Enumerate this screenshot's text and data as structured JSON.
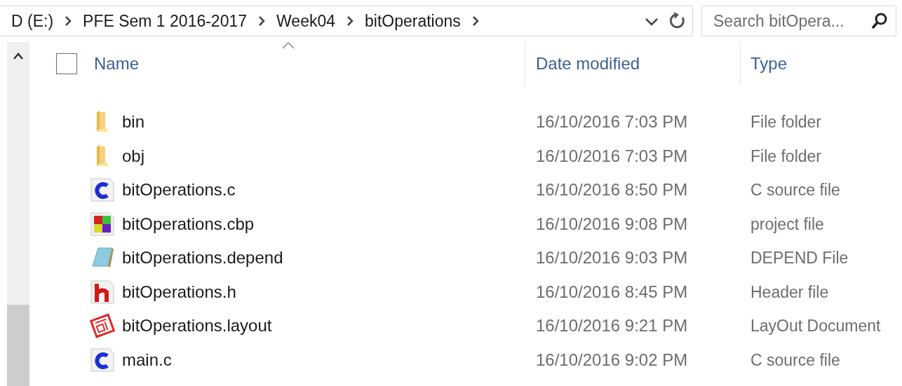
{
  "address_bar": {
    "crumbs": [
      "D (E:)",
      "PFE Sem 1 2016-2017",
      "Week04",
      "bitOperations"
    ]
  },
  "search": {
    "placeholder": "Search bitOpera..."
  },
  "select_all": {
    "checked": false
  },
  "columns": [
    {
      "label": "Name",
      "sorted": true
    },
    {
      "label": "Date modified",
      "sorted": false
    },
    {
      "label": "Type",
      "sorted": false
    }
  ],
  "files": [
    {
      "name": "bin",
      "date": "16/10/2016 7:03 PM",
      "type": "File folder",
      "kind": "folder"
    },
    {
      "name": "obj",
      "date": "16/10/2016 7:03 PM",
      "type": "File folder",
      "kind": "folder"
    },
    {
      "name": "bitOperations.c",
      "date": "16/10/2016 8:50 PM",
      "type": "C source file",
      "kind": "c"
    },
    {
      "name": "bitOperations.cbp",
      "date": "16/10/2016 9:08 PM",
      "type": "project file",
      "kind": "cbp"
    },
    {
      "name": "bitOperations.depend",
      "date": "16/10/2016 9:03 PM",
      "type": "DEPEND File",
      "kind": "depend"
    },
    {
      "name": "bitOperations.h",
      "date": "16/10/2016 8:45 PM",
      "type": "Header file",
      "kind": "h"
    },
    {
      "name": "bitOperations.layout",
      "date": "16/10/2016 9:21 PM",
      "type": "LayOut Document",
      "kind": "layout"
    },
    {
      "name": "main.c",
      "date": "16/10/2016 9:02 PM",
      "type": "C source file",
      "kind": "c"
    }
  ]
}
